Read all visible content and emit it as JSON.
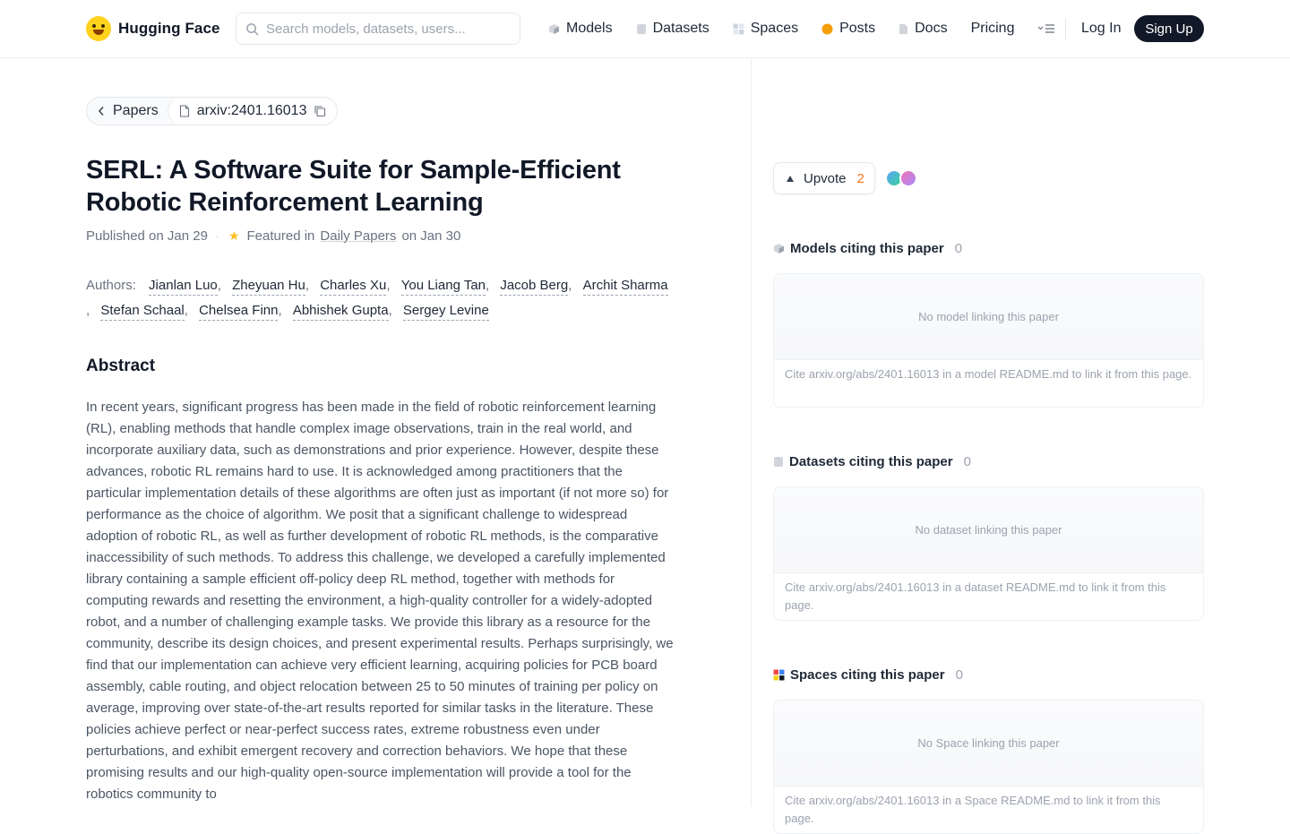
{
  "header": {
    "brand": "Hugging Face",
    "search_placeholder": "Search models, datasets, users...",
    "nav": [
      {
        "label": "Models",
        "icon": "models-cube-icon",
        "color": "#9ca3af"
      },
      {
        "label": "Datasets",
        "icon": "datasets-db-icon",
        "color": "#d1d5db"
      },
      {
        "label": "Spaces",
        "icon": "spaces-grid-icon",
        "color": "#cbd5e1"
      },
      {
        "label": "Posts",
        "icon": "posts-bubble-icon",
        "color": "#f59e0b"
      },
      {
        "label": "Docs",
        "icon": "docs-file-icon",
        "color": "#d1d5db"
      },
      {
        "label": "Pricing"
      }
    ],
    "login": "Log In",
    "signup": "Sign Up"
  },
  "breadcrumb": {
    "back_label": "Papers",
    "paper_id": "arxiv:2401.16013"
  },
  "paper": {
    "title": "SERL: A Software Suite for Sample-Efficient Robotic Reinforcement Learning",
    "published": "Published on Jan 29",
    "featured_prefix": "Featured in",
    "featured_link": "Daily Papers",
    "featured_suffix": "on Jan 30",
    "authors_label": "Authors:",
    "authors": [
      "Jianlan Luo",
      "Zheyuan Hu",
      "Charles Xu",
      "You Liang Tan",
      "Jacob Berg",
      "Archit Sharma",
      "Stefan Schaal",
      "Chelsea Finn",
      "Abhishek Gupta",
      "Sergey Levine"
    ],
    "abstract_heading": "Abstract",
    "abstract": "In recent years, significant progress has been made in the field of robotic reinforcement learning (RL), enabling methods that handle complex image observations, train in the real world, and incorporate auxiliary data, such as demonstrations and prior experience. However, despite these advances, robotic RL remains hard to use. It is acknowledged among practitioners that the particular implementation details of these algorithms are often just as important (if not more so) for performance as the choice of algorithm. We posit that a significant challenge to widespread adoption of robotic RL, as well as further development of robotic RL methods, is the comparative inaccessibility of such methods. To address this challenge, we developed a carefully implemented library containing a sample efficient off-policy deep RL method, together with methods for computing rewards and resetting the environment, a high-quality controller for a widely-adopted robot, and a number of challenging example tasks. We provide this library as a resource for the community, describe its design choices, and present experimental results. Perhaps surprisingly, we find that our implementation can achieve very efficient learning, acquiring policies for PCB board assembly, cable routing, and object relocation between 25 to 50 minutes of training per policy on average, improving over state-of-the-art results reported for similar tasks in the literature. These policies achieve perfect or near-perfect success rates, extreme robustness even under perturbations, and exhibit emergent recovery and correction behaviors. We hope that these promising results and our high-quality open-source implementation will provide a tool for the robotics community to"
  },
  "sidebar": {
    "upvote_label": "Upvote",
    "upvote_count": "2",
    "sections": [
      {
        "title": "Models citing this paper",
        "count": "0",
        "empty": "No model linking this paper",
        "cite": "Cite arxiv.org/abs/2401.16013 in a model README.md to link it from this page.",
        "icon": "models-cube-icon"
      },
      {
        "title": "Datasets citing this paper",
        "count": "0",
        "empty": "No dataset linking this paper",
        "cite": "Cite arxiv.org/abs/2401.16013 in a dataset README.md to link it from this page.",
        "icon": "datasets-db-icon"
      },
      {
        "title": "Spaces citing this paper",
        "count": "0",
        "empty": "No Space linking this paper",
        "cite": "Cite arxiv.org/abs/2401.16013 in a Space README.md to link it from this page.",
        "icon": "spaces-grid-icon"
      }
    ]
  },
  "colors": {
    "accent_upvote": "#f97316",
    "signup_bg": "#111827",
    "brand_yellow": "#ffd21e"
  }
}
